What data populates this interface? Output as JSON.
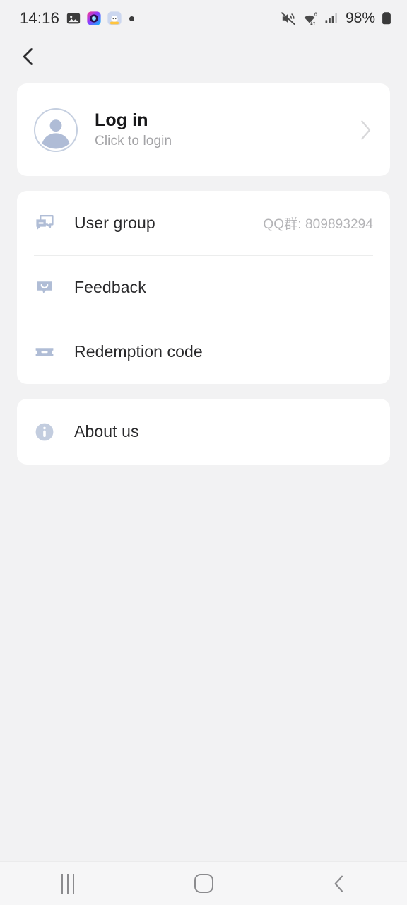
{
  "status_bar": {
    "time": "14:16",
    "battery_percent": "98%",
    "notification_icons": [
      "gallery-icon",
      "camera-app-icon",
      "sticker-app-icon",
      "more-notifications-dot"
    ],
    "system_icons": [
      "mute-icon",
      "wifi-6-icon",
      "cellular-signal-icon",
      "battery-icon"
    ]
  },
  "topbar": {
    "back_icon": "chevron-left-icon"
  },
  "login_card": {
    "title": "Log in",
    "subtitle": "Click to login",
    "avatar_icon": "account-circle-icon",
    "chevron_icon": "chevron-right-icon"
  },
  "menu": {
    "items": [
      {
        "label": "User group",
        "value": "QQ群: 809893294",
        "icon": "forum-chat-bubbles-icon"
      },
      {
        "label": "Feedback",
        "value": "",
        "icon": "feedback-smile-bubble-icon"
      },
      {
        "label": "Redemption code",
        "value": "",
        "icon": "ticket-coupon-icon"
      }
    ]
  },
  "about": {
    "items": [
      {
        "label": "About us",
        "value": "",
        "icon": "info-circle-icon"
      }
    ]
  },
  "navbar": {
    "recents_label": "recents-icon",
    "home_label": "home-icon",
    "back_label": "back-icon"
  },
  "colors": {
    "page_background": "#f2f2f3",
    "card_background": "#ffffff",
    "primary_text": "#29292b",
    "secondary_text": "#a3a3a6",
    "icon_tint": "#b0bdd6",
    "divider": "#eceded"
  }
}
